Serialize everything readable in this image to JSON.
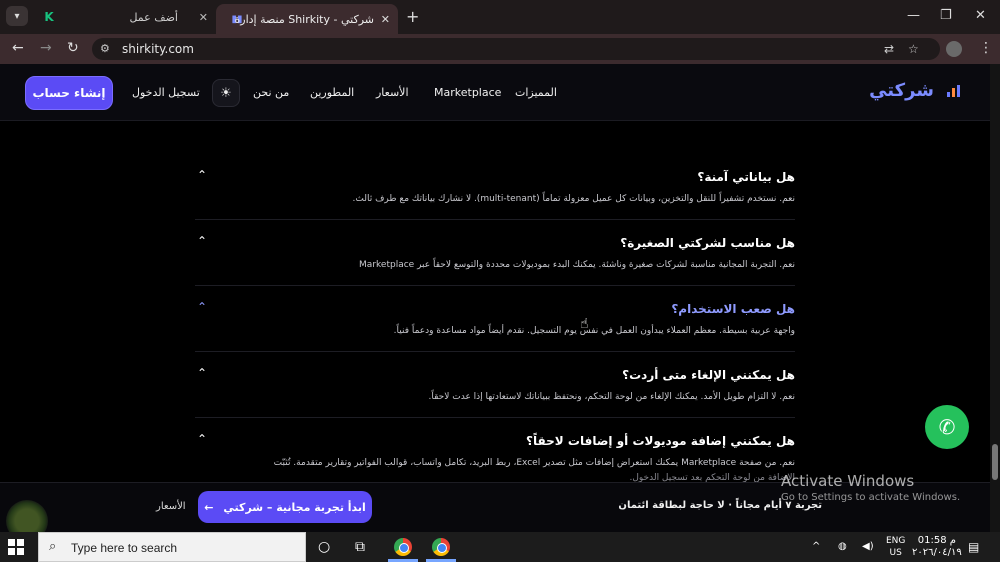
{
  "browser": {
    "tabs": [
      {
        "title": "أضف عمل",
        "favicon": "K"
      },
      {
        "title": "شركتي - Shirkity منصة إدارة الشر",
        "favicon": "bars"
      }
    ],
    "url": "shirkity.com"
  },
  "header": {
    "brand": "شركتي",
    "signup_label": "إنشاء حساب",
    "login_label": "تسجيل الدخول",
    "nav": [
      "من نحن",
      "المطورين",
      "الأسعار",
      "Marketplace",
      "المميزات"
    ]
  },
  "faq": [
    {
      "q": "هل بياناتي آمنة؟",
      "a": "نعم. نستخدم تشفيراً للنقل والتخزين، وبيانات كل عميل معزولة تماماً (multi-tenant). لا نشارك بياناتك مع طرف ثالث."
    },
    {
      "q": "هل مناسب لشركتي الصغيرة؟",
      "a": "نعم. التجربة المجانية مناسبة لشركات صغيرة وناشئة. يمكنك البدء بموديولات محددة والتوسع لاحقاً عبر Marketplace"
    },
    {
      "q": "هل صعب الاستخدام؟",
      "a": "واجهة عربية بسيطة. معظم العملاء يبدأون العمل في نفس يوم التسجيل. نقدم أيضاً مواد مساعدة ودعماً فنياً."
    },
    {
      "q": "هل يمكنني الإلغاء متى أردت؟",
      "a": "نعم. لا التزام طويل الأمد. يمكنك الإلغاء من لوحة التحكم، ونحتفظ ببياناتك لاستعادتها إذا عدت لاحقاً."
    },
    {
      "q": "هل يمكنني إضافة موديولات أو إضافات لاحقاً؟",
      "a": "نعم. من صفحة Marketplace يمكنك استعراض إضافات مثل تصدير Excel، ربط البريد، تكامل واتساب، قوالب الفواتير وتقارير متقدمة. تُثبّت",
      "a2": "الإضافة من لوحة التحكم بعد تسجيل الدخول."
    }
  ],
  "sticky": {
    "pricing_link": "الأسعار",
    "cta": "ابدأ تجربة مجانية – شركتي",
    "note": "تجربة ٧ أيام مجاناً · لا حاجة لبطاقة ائتمان"
  },
  "watermark": {
    "line1": "Activate Windows",
    "line2": "Go to Settings to activate Windows."
  },
  "taskbar": {
    "search_placeholder": "Type here to search",
    "lang": "ENG",
    "region": "US",
    "time": "01:58 م",
    "date": "٢٠٢٦/٠٤/١٩"
  },
  "colors": {
    "accent": "#5b4bf5",
    "brand": "#7c8cff",
    "whatsapp": "#25c15c"
  }
}
